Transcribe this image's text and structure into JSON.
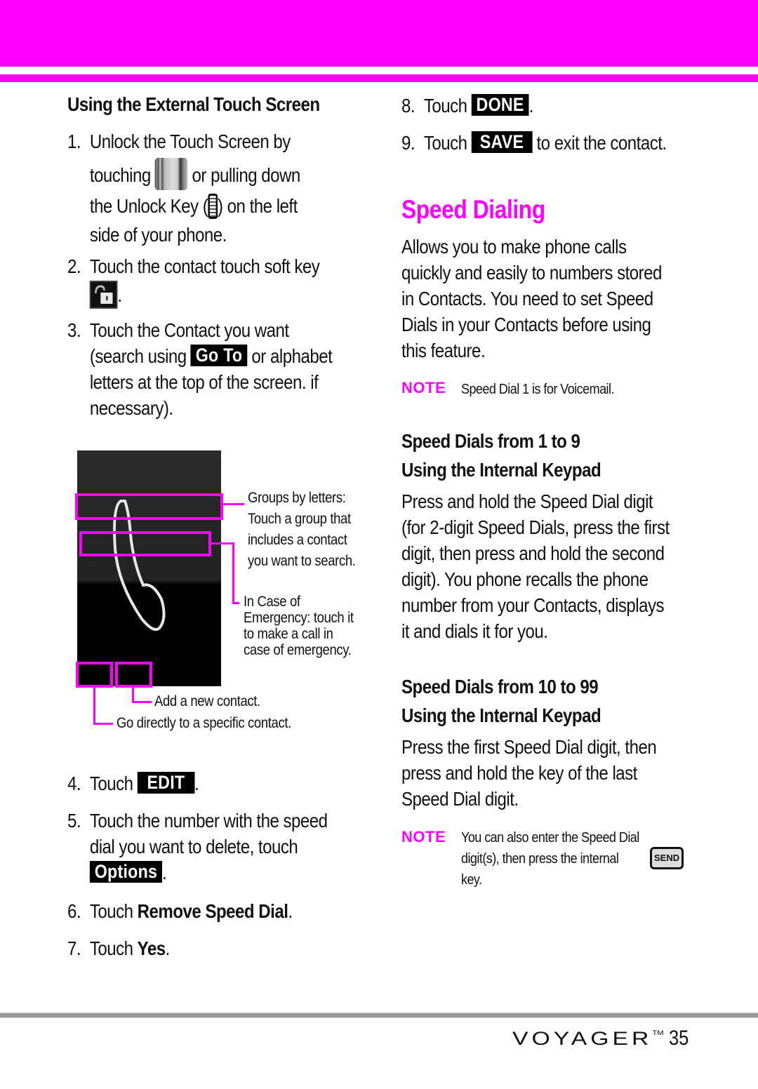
{
  "colors": {
    "accent": "#ff00ff",
    "chip_bg": "#000000",
    "rule": "#9a9a9a"
  },
  "left": {
    "heading": "Using the External Touch Screen",
    "steps": [
      {
        "num": "1.",
        "lines": [
          "Unlock the Touch Screen by",
          "touching",
          "or pulling down",
          "the Unlock Key (",
          ") on the left",
          "side of your phone."
        ],
        "icons": [
          "unlock-image-icon",
          "unlock-key-icon"
        ]
      },
      {
        "num": "2.",
        "text": "Touch the contact touch soft key",
        "tail": ".",
        "icon": "contact-soft-key-icon"
      },
      {
        "num": "3.",
        "lines": [
          "Touch the Contact you want",
          "(search using",
          "or alphabet",
          "letters at the top of the screen. if",
          "necessary)."
        ],
        "chip": "Go To"
      },
      {
        "num": "4.",
        "text": "Touch",
        "chip": "EDIT",
        "tail": "."
      },
      {
        "num": "5.",
        "lines": [
          "Touch the number with the speed",
          "dial you want to delete, touch"
        ],
        "chip": "Options",
        "tail": "."
      },
      {
        "num": "6.",
        "text": "Touch",
        "bold": "Remove Speed Dial",
        "tail": "."
      },
      {
        "num": "7.",
        "text": "Touch",
        "bold": "Yes",
        "tail": "."
      }
    ],
    "diagram": {
      "callouts": {
        "groups": [
          "Groups by letters:",
          "Touch a group that",
          "includes a contact",
          "you want to  search."
        ],
        "ice": [
          "In Case of",
          "Emergency: touch it",
          "to make a call in",
          "case of emergency."
        ],
        "add": "Add a new contact.",
        "goto": "Go directly to a specific contact."
      }
    }
  },
  "right": {
    "steps": [
      {
        "num": "8.",
        "text": "Touch",
        "chip": "DONE",
        "tail": "."
      },
      {
        "num": "9.",
        "text": "Touch",
        "chip": "SAVE",
        "tail": "to exit the contact."
      }
    ],
    "section_title": "Speed Dialing",
    "intro": [
      "Allows you to make phone calls",
      "quickly and easily to numbers stored",
      "in Contacts. You need to set Speed",
      "Dials in your Contacts before using",
      "this feature."
    ],
    "note1": {
      "label": "NOTE",
      "text": "Speed Dial 1 is for Voicemail."
    },
    "sub1": {
      "heading": [
        "Speed Dials from 1 to 9",
        "Using the Internal Keypad"
      ],
      "body": [
        "Press and hold the Speed Dial digit",
        "(for 2-digit Speed Dials, press the first",
        "digit, then press and hold the second",
        "digit). You phone recalls the phone",
        "number from your Contacts, displays",
        "it and dials it for you."
      ]
    },
    "sub2": {
      "heading": [
        "Speed Dials from 10 to 99",
        "Using the Internal Keypad"
      ],
      "body": [
        "Press the first Speed Dial digit, then",
        "press and hold the key of the last",
        "Speed Dial digit."
      ]
    },
    "note2": {
      "label": "NOTE",
      "lines": [
        "You can also enter the Speed Dial",
        "digit(s), then press the internal",
        "key."
      ],
      "key": "SEND"
    }
  },
  "footer": {
    "brand": "VOYAGER",
    "tm": "TM",
    "page": "35"
  }
}
